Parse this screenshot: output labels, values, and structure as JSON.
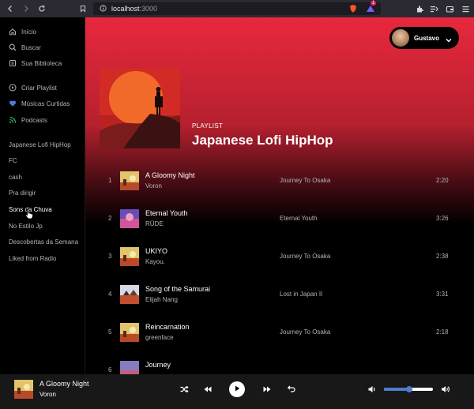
{
  "browser": {
    "url_host": "localhost",
    "url_port": ":3000",
    "notification_count": "1"
  },
  "sidebar": {
    "nav": [
      {
        "label": "Início",
        "icon": "home-icon"
      },
      {
        "label": "Buscar",
        "icon": "search-icon"
      },
      {
        "label": "Sua Biblioteca",
        "icon": "library-icon"
      }
    ],
    "actions": [
      {
        "label": "Criar Playlist",
        "icon": "add-circle-icon"
      },
      {
        "label": "Músicas Curtidas",
        "icon": "heart-icon"
      },
      {
        "label": "Podcasts",
        "icon": "rss-icon"
      }
    ],
    "playlists": [
      "Japanese Lofi HipHop",
      "FC",
      "cash",
      "Pra dirigir",
      "Sons da Chuva",
      "No Estilo Jp",
      "Descobertas da Semana",
      "Liked from Radio"
    ],
    "active_playlist": 4
  },
  "user": {
    "name": "Gustavo"
  },
  "playlist": {
    "type": "PLAYLIST",
    "title": "Japanese Lofi HipHop"
  },
  "tracks": [
    {
      "num": "1",
      "name": "A Gloomy Night",
      "artist": "Voron",
      "album": "Journey To Osaka",
      "duration": "2:20"
    },
    {
      "num": "2",
      "name": "Eternal Youth",
      "artist": "RÜDE",
      "album": "Eternal Youth",
      "duration": "3:26"
    },
    {
      "num": "3",
      "name": "UKIYO",
      "artist": "Kayou.",
      "album": "Journey To Osaka",
      "duration": "2:38"
    },
    {
      "num": "4",
      "name": "Song of the Samurai",
      "artist": "Elijah Nang",
      "album": "Lost in Japan II",
      "duration": "3:31"
    },
    {
      "num": "5",
      "name": "Reincarnation",
      "artist": "greenface",
      "album": "Journey To Osaka",
      "duration": "2:18"
    },
    {
      "num": "6",
      "name": "Journey",
      "artist": "",
      "album": "",
      "duration": ""
    }
  ],
  "now_playing": {
    "title": "A Gloomy Night",
    "artist": "Voron",
    "volume": 0.52
  },
  "colors": {
    "accent": "#4f7bd0",
    "header_red": "#e8283d",
    "bg": "#000000",
    "player_bg": "#181818"
  }
}
